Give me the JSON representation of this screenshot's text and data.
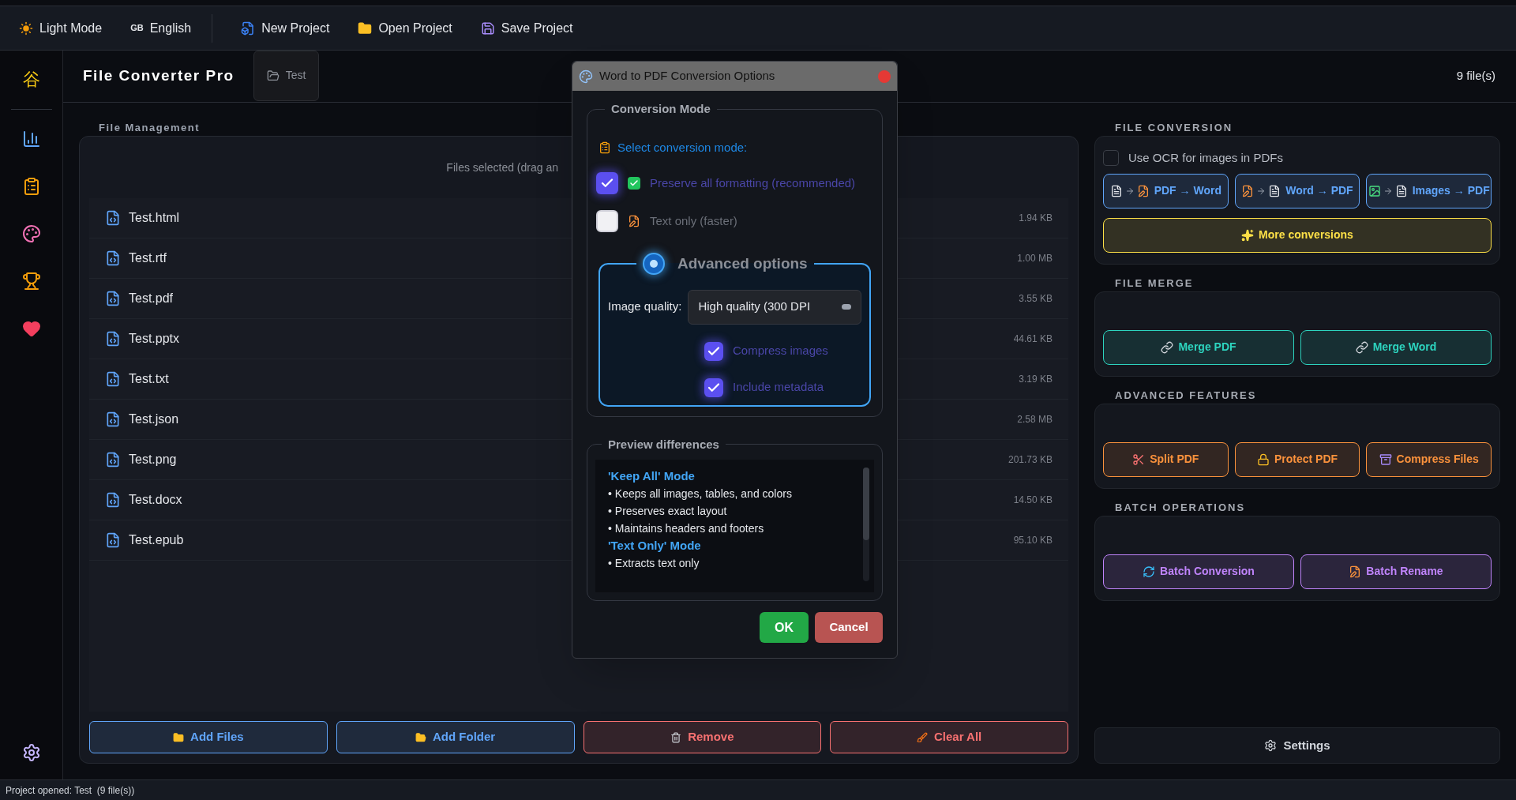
{
  "toolbar": {
    "items": [
      {
        "label": "Light Mode"
      },
      {
        "prefix": "GB",
        "label": "English"
      },
      {
        "label": "New Project"
      },
      {
        "label": "Open Project"
      },
      {
        "label": "Save Project"
      }
    ]
  },
  "sidebar": {
    "logo": "谷"
  },
  "header": {
    "title": "File Converter Pro",
    "project_tab": "Test",
    "file_count": "9 file(s)"
  },
  "file_management": {
    "title": "File Management",
    "hint": "Files selected (drag an",
    "files": [
      {
        "name": "Test.html",
        "size": "1.94 KB"
      },
      {
        "name": "Test.rtf",
        "size": "1.00 MB"
      },
      {
        "name": "Test.pdf",
        "size": "3.55 KB"
      },
      {
        "name": "Test.pptx",
        "size": "44.61 KB"
      },
      {
        "name": "Test.txt",
        "size": "3.19 KB"
      },
      {
        "name": "Test.json",
        "size": "2.58 MB"
      },
      {
        "name": "Test.png",
        "size": "201.73 KB"
      },
      {
        "name": "Test.docx",
        "size": "14.50 KB"
      },
      {
        "name": "Test.epub",
        "size": "95.10 KB"
      }
    ],
    "buttons": [
      {
        "label": "Add Files",
        "color": "#60a5fa"
      },
      {
        "label": "Add Folder",
        "color": "#60a5fa"
      },
      {
        "label": "Remove",
        "color": "#f87171"
      },
      {
        "label": "Clear All",
        "color": "#f87171"
      }
    ]
  },
  "right_panel": {
    "sections": [
      {
        "title": "FILE CONVERSION",
        "ocr": {
          "label": "Use OCR for images in PDFs",
          "checked": false
        },
        "buttons": [
          {
            "label": "PDF → Word",
            "color": "#60a5fa"
          },
          {
            "label": "Word → PDF",
            "color": "#60a5fa"
          },
          {
            "label": "Images → PDF",
            "color": "#60a5fa"
          }
        ],
        "wide_button": {
          "label": "More conversions",
          "color": "#fde047"
        }
      },
      {
        "title": "FILE MERGE",
        "buttons": [
          {
            "label": "Merge PDF",
            "color": "#2dd4bf"
          },
          {
            "label": "Merge Word",
            "color": "#2dd4bf"
          }
        ]
      },
      {
        "title": "ADVANCED FEATURES",
        "buttons": [
          {
            "label": "Split PDF",
            "color": "#fb923c"
          },
          {
            "label": "Protect PDF",
            "color": "#fb923c"
          },
          {
            "label": "Compress Files",
            "color": "#fb923c"
          }
        ]
      },
      {
        "title": "BATCH OPERATIONS",
        "buttons": [
          {
            "label": "Batch Conversion",
            "color": "#c084fc"
          },
          {
            "label": "Batch Rename",
            "color": "#c084fc"
          }
        ]
      }
    ],
    "settings_button": "Settings"
  },
  "dialog": {
    "title": "Word to PDF Conversion Options",
    "mode_section": {
      "title": "Conversion Mode",
      "prompt": "Select conversion mode:",
      "options": [
        {
          "label": "Preserve all formatting (recommended)",
          "checked": true
        },
        {
          "label": "Text only (faster)",
          "checked": false
        }
      ]
    },
    "advanced": {
      "title": "Advanced options",
      "enabled": true,
      "quality_label": "Image quality:",
      "quality_value": "High quality (300 DPI",
      "options": [
        {
          "label": "Compress images",
          "checked": true
        },
        {
          "label": "Include metadata",
          "checked": true
        }
      ]
    },
    "preview": {
      "title": "Preview differences",
      "blocks": [
        {
          "heading": "'Keep All' Mode",
          "lines": [
            "• Keeps all images, tables, and colors",
            "• Preserves exact layout",
            "• Maintains headers and footers"
          ]
        },
        {
          "heading": "'Text Only' Mode",
          "lines": [
            "• Extracts text only"
          ]
        }
      ]
    },
    "ok": "OK",
    "cancel": "Cancel"
  },
  "status_bar": "Project opened: Test  (9 file(s))"
}
